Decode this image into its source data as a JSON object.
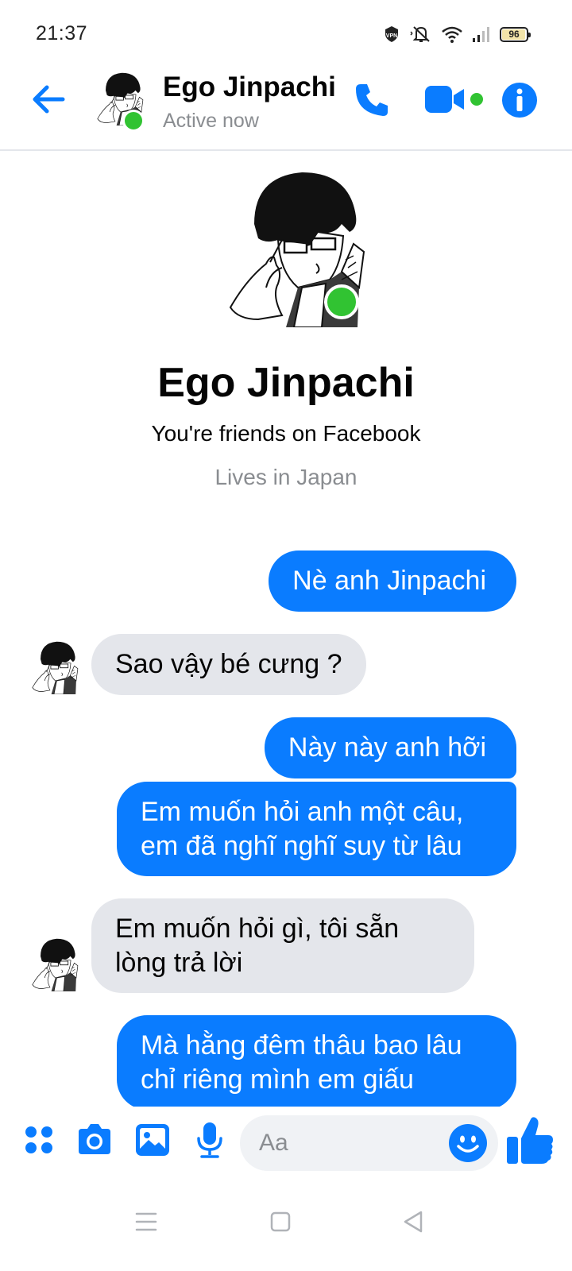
{
  "status_bar": {
    "time": "21:37",
    "battery_level": 96,
    "battery_text": "96",
    "icons": [
      "vpn-icon",
      "mute-icon",
      "wifi-icon",
      "signal-icon",
      "battery-icon"
    ]
  },
  "header": {
    "contact_name": "Ego Jinpachi",
    "status": "Active now",
    "online_color": "#31c332",
    "accent_color": "#0a7cff"
  },
  "profile": {
    "name": "Ego Jinpachi",
    "friends_text": "You're friends on Facebook",
    "location": "Lives in Japan"
  },
  "messages": [
    {
      "direction": "outgoing",
      "text": "Nè anh Jinpachi"
    },
    {
      "direction": "incoming",
      "text": "Sao vậy bé cưng ?"
    },
    {
      "direction": "outgoing",
      "text": "Này này anh hỡi"
    },
    {
      "direction": "outgoing",
      "lines": [
        "Em muốn hỏi anh một câu,",
        "em đã nghĩ nghĩ suy từ lâu"
      ]
    },
    {
      "direction": "incoming",
      "lines": [
        "Em muốn hỏi gì, tôi sẵn",
        "lòng trả lời"
      ]
    },
    {
      "direction": "outgoing",
      "lines": [
        "Mà hằng đêm thâu bao lâu",
        "chỉ riêng mình em giấu"
      ]
    }
  ],
  "composer": {
    "placeholder": "Aa",
    "icons": [
      "menu-dots-icon",
      "camera-icon",
      "gallery-icon",
      "microphone-icon",
      "emoji-icon",
      "like-icon"
    ]
  },
  "colors": {
    "outgoing_bubble": "#0a7cff",
    "incoming_bubble": "#e4e6eb",
    "secondary_text": "#8a8d91"
  }
}
